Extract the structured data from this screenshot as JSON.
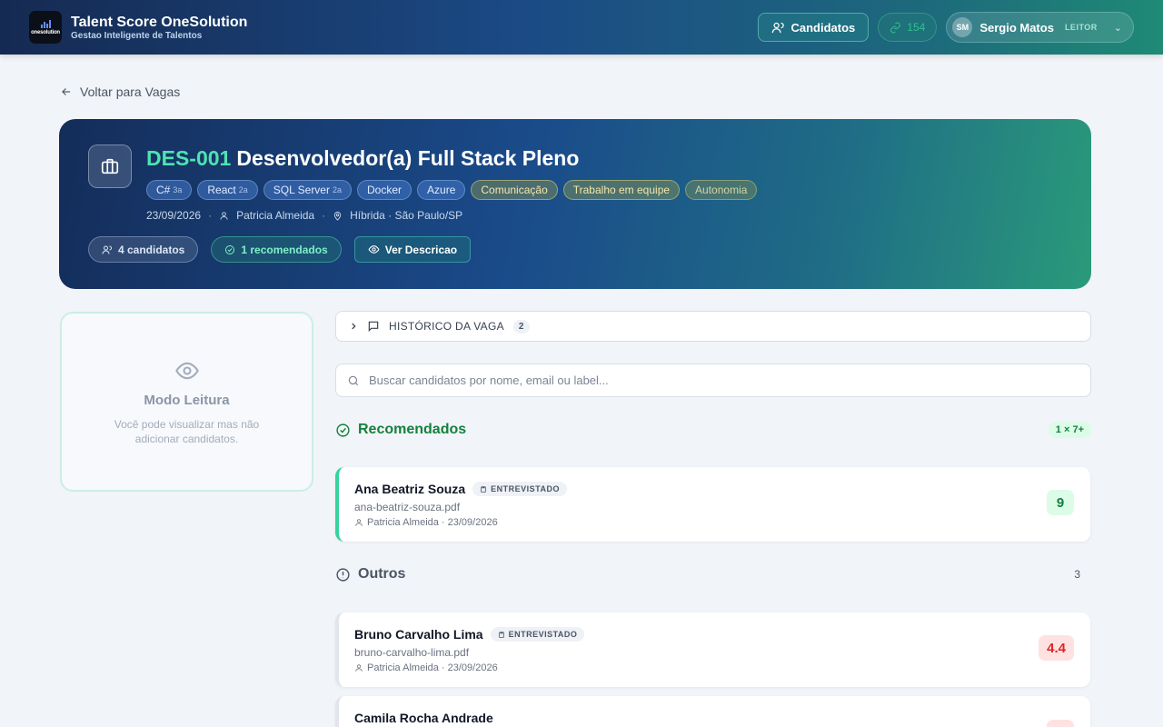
{
  "app": {
    "title": "Talent Score OneSolution",
    "subtitle": "Gestao Inteligente de Talentos",
    "logo_text": "onesolution"
  },
  "header": {
    "candidatos_label": "Candidatos",
    "credits_count": "154",
    "user_initials": "SM",
    "user_name": "Sergio Matos",
    "user_role": "LEITOR"
  },
  "back_label": "Voltar para Vagas",
  "job": {
    "code": "DES-001",
    "title": "Desenvolvedor(a) Full Stack Pleno",
    "tech_tags": [
      {
        "name": "C#",
        "years": "3a"
      },
      {
        "name": "React",
        "years": "2a"
      },
      {
        "name": "SQL Server",
        "years": "2a"
      },
      {
        "name": "Docker",
        "years": ""
      },
      {
        "name": "Azure",
        "years": ""
      }
    ],
    "soft_tags": [
      "Comunicação",
      "Trabalho em equipe",
      "Autonomia"
    ],
    "date": "23/09/2026",
    "recruiter": "Patricia Almeida",
    "location": "Híbrida · São Paulo/SP",
    "candidates_label": "4 candidatos",
    "recommended_label": "1 recomendados",
    "description_label": "Ver Descricao"
  },
  "read_mode": {
    "title": "Modo Leitura",
    "text": "Você pode visualizar mas não adicionar candidatos."
  },
  "history": {
    "label": "HISTÓRICO DA VAGA",
    "count": "2"
  },
  "search": {
    "placeholder": "Buscar candidatos por nome, email ou label..."
  },
  "recommended": {
    "title": "Recomendados",
    "badge": "1 × 7+",
    "candidates": [
      {
        "name": "Ana Beatriz Souza",
        "status": "ENTREVISTADO",
        "file": "ana-beatriz-souza.pdf",
        "meta": "Patricia Almeida · 23/09/2026",
        "score": "9"
      }
    ]
  },
  "others": {
    "title": "Outros",
    "count": "3",
    "candidates": [
      {
        "name": "Bruno Carvalho Lima",
        "status": "ENTREVISTADO",
        "file": "bruno-carvalho-lima.pdf",
        "meta": "Patricia Almeida · 23/09/2026",
        "score": "4.4"
      },
      {
        "name": "Camila Rocha Andrade",
        "status": "",
        "file": "",
        "meta": "",
        "score": ""
      }
    ]
  },
  "colors": {
    "accent_green": "#15803d",
    "score_bad": "#dc2626",
    "code_green": "#4ee3b0"
  }
}
